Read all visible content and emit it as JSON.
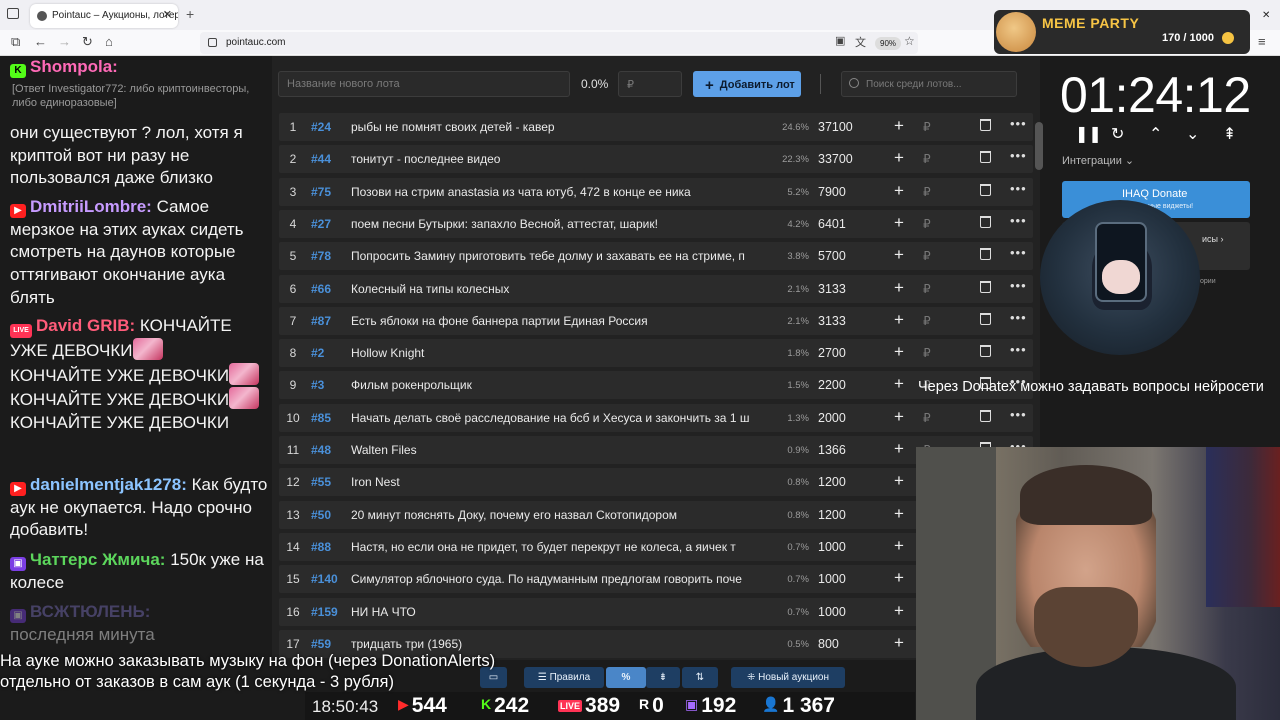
{
  "browser": {
    "tab_title": "Pointauc – Аукционы, лотереи",
    "url": "pointauc.com",
    "zoom": "90%"
  },
  "meme_party": {
    "title": "MEME PARTY",
    "count": "170 / 1000"
  },
  "chat": {
    "messages": [
      {
        "nick": "Shompola:",
        "text": "",
        "color": "#ff6ab7",
        "platform": "K"
      },
      {
        "reply": "[Ответ Investigator772: либо криптоинвесторы, либо единоразовые]"
      },
      {
        "text": "они существуют ? лол, хотя я криптой вот ни разу не пользовался даже близко"
      },
      {
        "nick": "DmitriiLombre:",
        "text": "Самое мерзкое на этих ауках сидеть смотреть на даунов которые оттягивают окончание аука блять",
        "color": "#c79bff",
        "platform": "YT"
      },
      {
        "nick": "David GRIB:",
        "text": "КОНЧАЙТЕ УЖЕ ДЕВОЧКИ",
        "color": "#ff5c7a",
        "platform": "LIVE"
      },
      {
        "nick": "danielmentjak1278:",
        "text": "Как будто аук не окупается. Надо срочно добавить!",
        "color": "#8cc4ff",
        "platform": "YT"
      },
      {
        "nick": "Чаттерс Жмича:",
        "text": "150к уже на колесе",
        "color": "#5cd65c",
        "platform": "TW"
      },
      {
        "nick": "ВСЖТЮЛЕНЬ:",
        "text": "последняя минута",
        "color": "#7b6fbf",
        "platform": "TW"
      }
    ]
  },
  "toolbar": {
    "lot_placeholder": "Название нового лота",
    "percent": "0.0%",
    "rub_placeholder": "₽",
    "add_label": "Добавить лот",
    "search_placeholder": "Поиск среди лотов..."
  },
  "lots": [
    {
      "idx": "1",
      "id": "#24",
      "name": "рыбы не помнят своих детей - кавер",
      "pct": "24.6%",
      "amount": "37100"
    },
    {
      "idx": "2",
      "id": "#44",
      "name": "тонитут - последнее видео",
      "pct": "22.3%",
      "amount": "33700"
    },
    {
      "idx": "3",
      "id": "#75",
      "name": "Позови на стрим anastasia из чата ютуб, 472 в конце ее ника",
      "pct": "5.2%",
      "amount": "7900"
    },
    {
      "idx": "4",
      "id": "#27",
      "name": "поем песни Бутырки: запахло Весной, аттестат, шарик!",
      "pct": "4.2%",
      "amount": "6401"
    },
    {
      "idx": "5",
      "id": "#78",
      "name": "Попросить Замину приготовить тебе долму и захавать ее на стриме, п",
      "pct": "3.8%",
      "amount": "5700"
    },
    {
      "idx": "6",
      "id": "#66",
      "name": "Колесный на типы колесных",
      "pct": "2.1%",
      "amount": "3133"
    },
    {
      "idx": "7",
      "id": "#87",
      "name": "Есть яблоки на фоне баннера партии Единая Россия",
      "pct": "2.1%",
      "amount": "3133"
    },
    {
      "idx": "8",
      "id": "#2",
      "name": "Hollow Knight",
      "pct": "1.8%",
      "amount": "2700"
    },
    {
      "idx": "9",
      "id": "#3",
      "name": "Фильм рокенрольщик",
      "pct": "1.5%",
      "amount": "2200"
    },
    {
      "idx": "10",
      "id": "#85",
      "name": "Начать делать своё расследование на бсб и Хесуса и закончить за 1 ш",
      "pct": "1.3%",
      "amount": "2000"
    },
    {
      "idx": "11",
      "id": "#48",
      "name": "Walten Files",
      "pct": "0.9%",
      "amount": "1366"
    },
    {
      "idx": "12",
      "id": "#55",
      "name": "Iron Nest",
      "pct": "0.8%",
      "amount": "1200"
    },
    {
      "idx": "13",
      "id": "#50",
      "name": "20 минут пояснять Доку, почему его назвал Скотопидором",
      "pct": "0.8%",
      "amount": "1200"
    },
    {
      "idx": "14",
      "id": "#88",
      "name": "Настя, но если она не придет, то будет перекрут не колеса, а яичек т",
      "pct": "0.7%",
      "amount": "1000"
    },
    {
      "idx": "15",
      "id": "#140",
      "name": "Симулятор яблочного суда. По надуманным предлогам говорить поче",
      "pct": "0.7%",
      "amount": "1000"
    },
    {
      "idx": "16",
      "id": "#159",
      "name": "НИ НА ЧТО",
      "pct": "0.7%",
      "amount": "1000"
    },
    {
      "idx": "17",
      "id": "#59",
      "name": "тридцать три (1965)",
      "pct": "0.5%",
      "amount": "800"
    }
  ],
  "bottom_toolbar": {
    "rules": "Правила",
    "percent": "%",
    "new_auction": "Новый аукцион"
  },
  "timer": "01:24:12",
  "integrations": {
    "label": "Интеграции",
    "donate_title": "IHAQ Donate",
    "donate_sub": "уникальные виджеты!",
    "card2": "исы",
    "card2_sub": "ории"
  },
  "overlay_question": "Через Donatex можно задавать вопросы нейросети",
  "bottom_note": [
    "На ауке можно заказывать музыку на фон (через DonationAlerts)",
    "отдельно от заказов в сам аук (1 секунда - 3 рубля)"
  ],
  "stats": {
    "clock": "18:50:43",
    "youtube": "544",
    "kick": "242",
    "live": "389",
    "r": "0",
    "twitch": "192",
    "viewers": "1 367"
  }
}
